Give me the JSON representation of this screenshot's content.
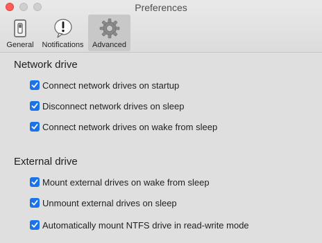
{
  "window": {
    "title": "Preferences"
  },
  "toolbar": {
    "tabs": [
      {
        "label": "General",
        "icon": "switch-icon",
        "selected": false
      },
      {
        "label": "Notifications",
        "icon": "exclamation-bubble-icon",
        "selected": false
      },
      {
        "label": "Advanced",
        "icon": "gear-icon",
        "selected": true
      }
    ]
  },
  "sections": {
    "network": {
      "heading": "Network drive",
      "options": [
        {
          "label": "Connect network drives on startup",
          "checked": true
        },
        {
          "label": "Disconnect network drives on sleep",
          "checked": true
        },
        {
          "label": "Connect network drives on wake from sleep",
          "checked": true
        }
      ]
    },
    "external": {
      "heading": "External drive",
      "options": [
        {
          "label": "Mount external drives on wake from sleep",
          "checked": true
        },
        {
          "label": "Unmount external drives on sleep",
          "checked": true
        },
        {
          "label": "Automatically mount NTFS drive in read-write mode",
          "checked": true
        }
      ]
    }
  },
  "colors": {
    "checkbox_accent": "#1a73e8",
    "close_button": "#fe5f57"
  }
}
